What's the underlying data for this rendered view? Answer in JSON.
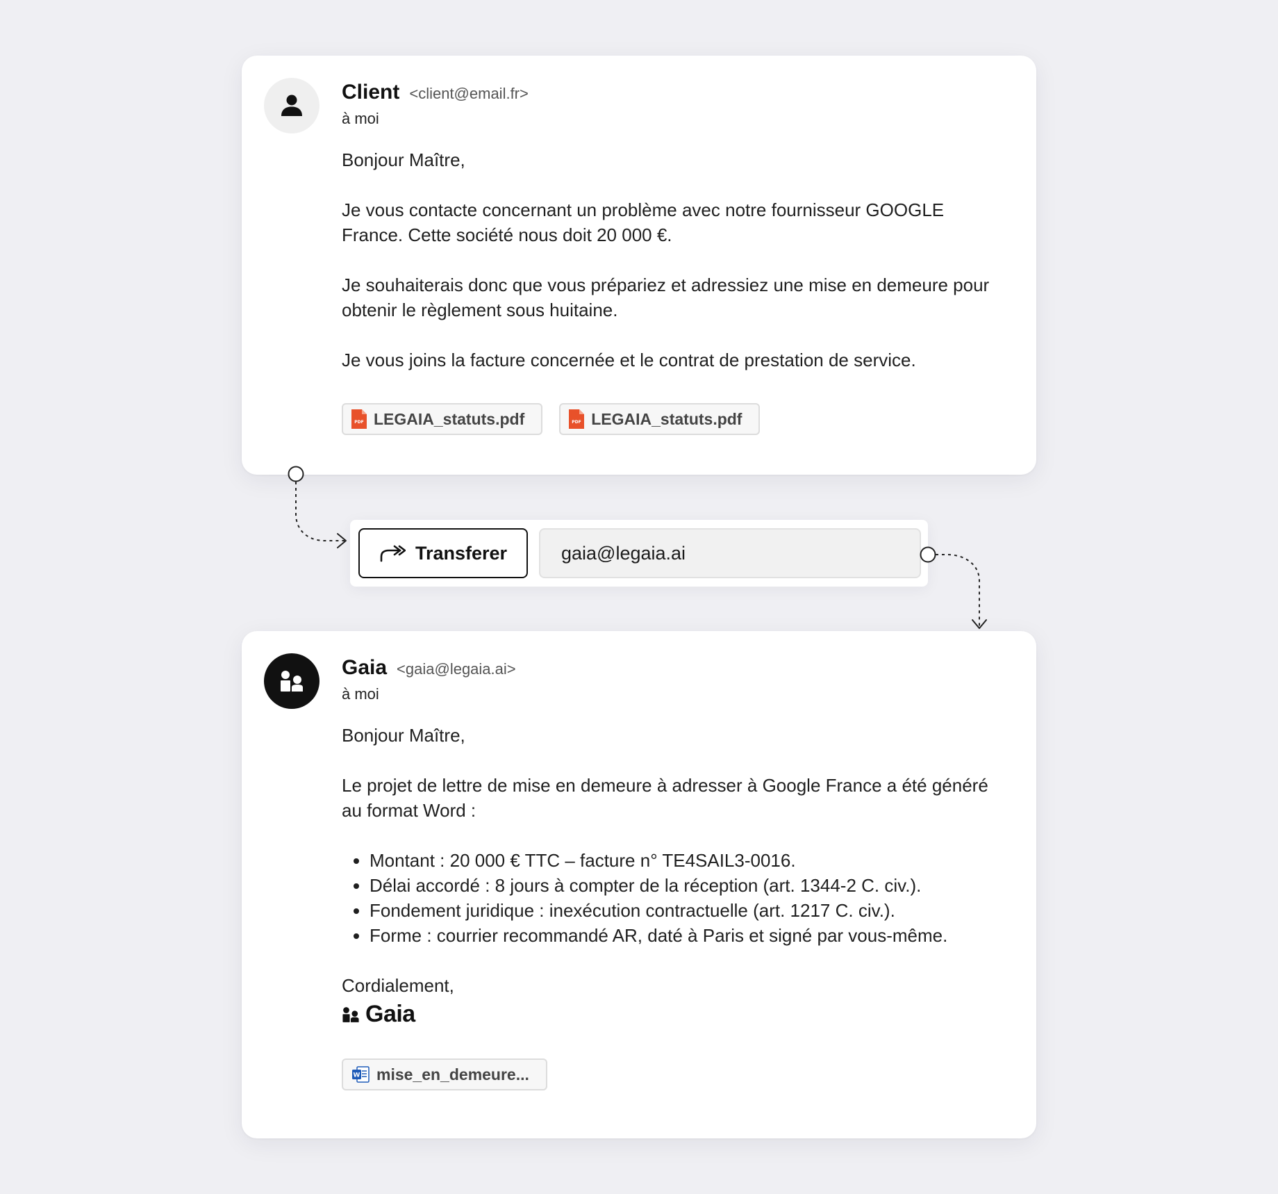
{
  "client_email": {
    "sender_name": "Client",
    "sender_email": "<client@email.fr>",
    "recipient": "à moi",
    "greeting": "Bonjour Maître,",
    "paragraphs": [
      "Je vous contacte concernant un problème avec notre fournisseur GOOGLE France. Cette société nous doit 20 000 €.",
      "Je souhaiterais donc que vous prépariez et adressiez une mise en demeure pour obtenir le règlement sous huitaine.",
      "Je vous joins la facture concernée et le contrat de prestation de service."
    ],
    "attachments": [
      {
        "name": "LEGAIA_statuts.pdf",
        "icon": "pdf-file-icon"
      },
      {
        "name": "LEGAIA_statuts.pdf",
        "icon": "pdf-file-icon"
      }
    ]
  },
  "forward": {
    "button_label": "Transferer",
    "recipient_value": "gaia@legaia.ai"
  },
  "gaia_email": {
    "sender_name": "Gaia",
    "sender_email": "<gaia@legaia.ai>",
    "recipient": "à moi",
    "greeting": "Bonjour Maître,",
    "intro": "Le projet de lettre de mise en demeure à adresser à Google France a été généré au format Word :",
    "bullets": [
      "Montant : 20 000 € TTC – facture n° TE4SAIL3-0016.",
      "Délai accordé : 8 jours à compter de la réception (art. 1344-2 C. civ.).",
      "Fondement juridique : inexécution contractuelle (art. 1217 C. civ.).",
      "Forme : courrier recommandé AR, daté à Paris et signé par vous-même."
    ],
    "closing": "Cordialement,",
    "signature": "Gaia",
    "attachment": {
      "name": "mise_en_demeure...",
      "icon": "word-file-icon"
    }
  },
  "colors": {
    "background": "#efeff3",
    "card": "#ffffff",
    "pdf_icon": "#e8512a",
    "word_icon": "#1e5bb8",
    "text": "#1b1b1b"
  }
}
